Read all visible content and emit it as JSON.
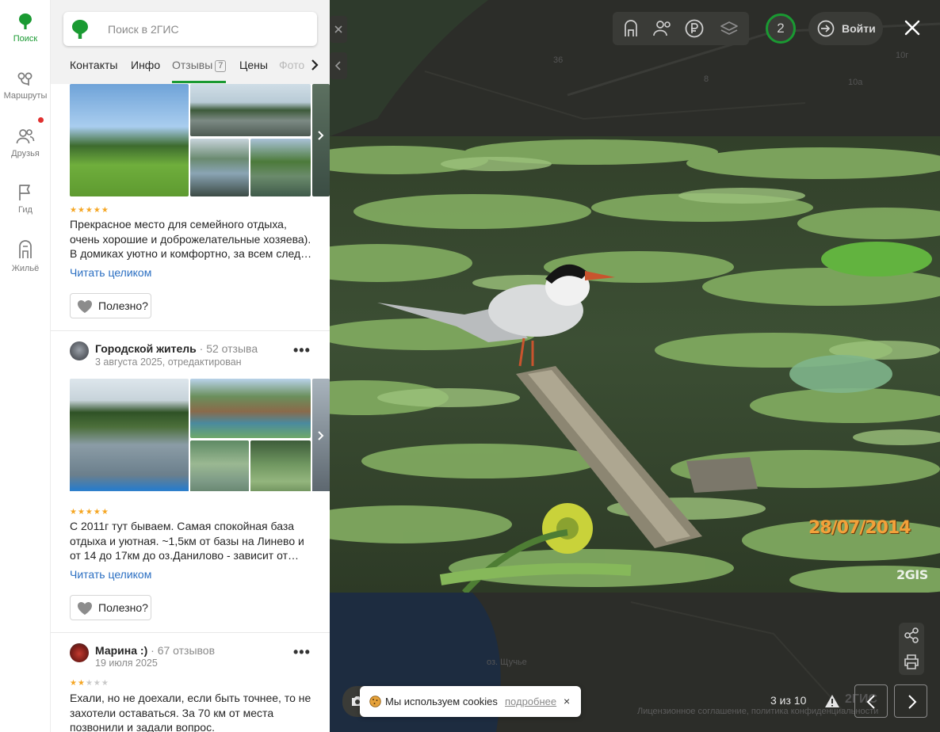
{
  "nav": {
    "items": [
      {
        "label": "Поиск",
        "icon": "pin-icon",
        "active": true
      },
      {
        "label": "Маршруты",
        "icon": "route-icon"
      },
      {
        "label": "Друзья",
        "icon": "friends-icon"
      },
      {
        "label": "Гид",
        "icon": "flag-icon"
      },
      {
        "label": "Жильё",
        "icon": "building-icon"
      }
    ]
  },
  "search": {
    "placeholder": "Поиск в 2ГИС"
  },
  "tabs": {
    "items": [
      "Контакты",
      "Инфо",
      "Отзывы",
      "Цены",
      "Фото"
    ],
    "reviews_count": "7",
    "active": "Отзывы"
  },
  "reviews": [
    {
      "rating": 5,
      "text": "Прекрасное место для семейного отдыха, очень хорошие и доброжелательные хозяева). В домиках уютно и комфортно, за всем след…",
      "read_more": "Читать целиком",
      "useful": "Полезно?"
    },
    {
      "author": "Городской житель",
      "author_reviews": "52 отзыва",
      "date": "3 августа 2025, отредактирован",
      "rating": 5,
      "text": "С 2011г тут бываем. Самая спокойная база отдыха и уютная. ~1,5км от базы на Линево и от 14 до 17км до оз.Данилово - зависит от…",
      "read_more": "Читать целиком",
      "useful": "Полезно?",
      "more": "•••"
    },
    {
      "author": "Марина :)",
      "author_reviews": "67 отзывов",
      "date": "19 июля 2025",
      "rating": 2,
      "text": "Ехали, но не доехали, если быть точнее, то не захотели оставаться. За 70 км от места позвонили и задали вопрос.",
      "more": "•••"
    }
  ],
  "viewer": {
    "photo_date_stamp": "28/07/2014",
    "watermark": "2GIS",
    "counter": "3 из 10",
    "login": "Войти",
    "friends_count": "2",
    "license": "Лицензионное соглашение, политика конфиденциальности",
    "brand": "2ГИС",
    "map_labels": [
      "36",
      "8",
      "10а",
      "10г",
      "оз. Щучье"
    ]
  },
  "cookie": {
    "message": "Мы используем cookies",
    "link": "подробнее",
    "close": "×"
  },
  "colors": {
    "accent": "#1a9a32",
    "link": "#2b6fc2",
    "star": "#f5a623",
    "badge_dot": "#e0302f"
  }
}
